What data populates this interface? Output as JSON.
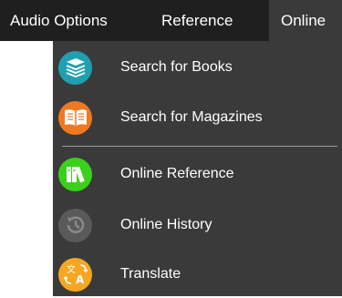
{
  "menubar": {
    "items": [
      {
        "label": "Audio Options"
      },
      {
        "label": "Reference"
      },
      {
        "label": "Online",
        "active": true
      }
    ]
  },
  "dropdown": {
    "items": [
      {
        "label": "Search for Books",
        "icon": "books-stack-icon",
        "color": "#1f9fb0"
      },
      {
        "label": "Search for Magazines",
        "icon": "open-magazine-icon",
        "color": "#f07820"
      },
      {
        "label": "Online Reference",
        "icon": "reference-books-icon",
        "color": "#3ad11a"
      },
      {
        "label": "Online History",
        "icon": "history-clock-icon",
        "color": "#5a5a5a"
      },
      {
        "label": "Translate",
        "icon": "translate-icon",
        "color": "#f5a623"
      }
    ]
  },
  "colors": {
    "menubar_bg": "#1f1f1f",
    "dropdown_bg": "#3a3a3a",
    "active_tab_bg": "#3a3a3a",
    "text": "#ffffff",
    "separator": "#9a9a9a"
  }
}
